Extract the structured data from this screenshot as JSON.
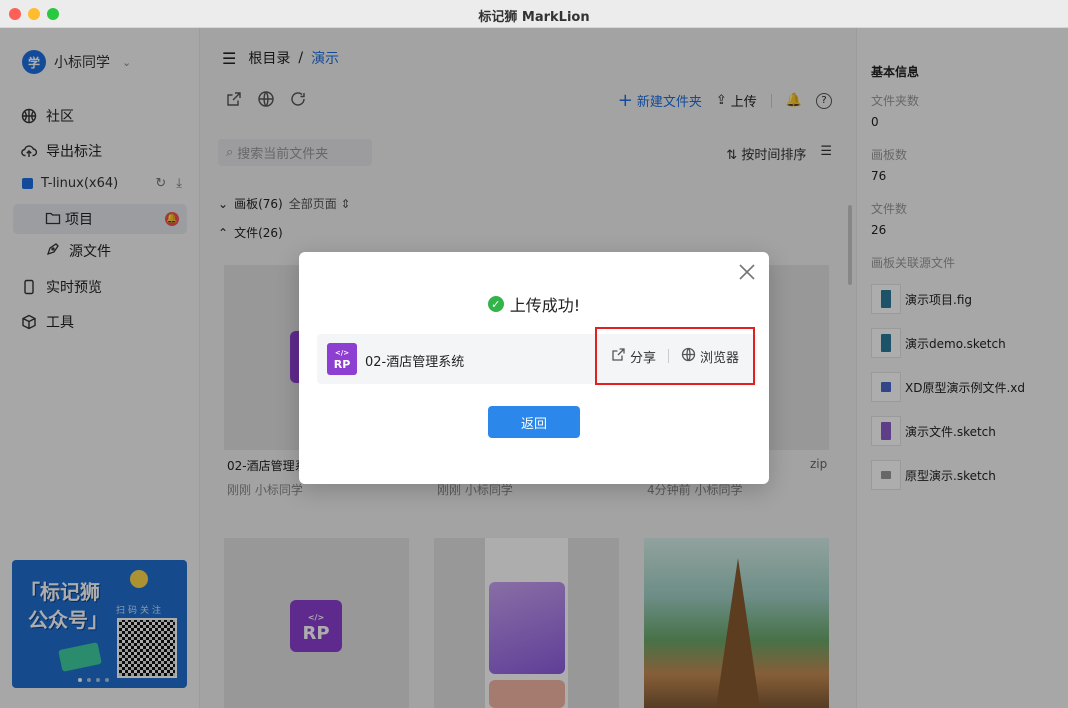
{
  "window": {
    "title": "标记狮 MarkLion"
  },
  "user": {
    "avatar_text": "学",
    "name": "小标同学"
  },
  "nav": {
    "community": "社区",
    "export": "导出标注",
    "workspace": "T-linux(x64)",
    "project": "项目",
    "source": "源文件",
    "preview": "实时预览",
    "tools": "工具"
  },
  "banner": {
    "title_line1": "「标记狮",
    "title_line2": "公众号」",
    "scan_text": "扫码关注"
  },
  "main": {
    "breadcrumb_root": "根目录",
    "breadcrumb_sep": "/",
    "breadcrumb_current": "演示",
    "new_folder": "新建文件夹",
    "upload": "上传",
    "search_placeholder": "搜索当前文件夹",
    "sort_label": "按时间排序",
    "boards_section": "画板(76)",
    "all_pages": "全部页面",
    "files_section": "文件(26)",
    "cards": [
      {
        "name": "02-酒店管理系",
        "meta": "刚刚 小标同学"
      },
      {
        "name": "",
        "meta": "刚刚 小标同学"
      },
      {
        "name": "zip",
        "meta": "4分钟前 小标同学"
      }
    ]
  },
  "panel": {
    "title": "基本信息",
    "folders_label": "文件夹数",
    "folders_value": "0",
    "boards_label": "画板数",
    "boards_value": "76",
    "files_label": "文件数",
    "files_value": "26",
    "linked_label": "画板关联源文件",
    "linked_files": [
      "演示项目.fig",
      "演示demo.sketch",
      "XD原型演示例文件.xd",
      "演示文件.sketch",
      "原型演示.sketch"
    ]
  },
  "modal": {
    "title": "上传成功!",
    "file_name": "02-酒店管理系统",
    "rp_label": "RP",
    "share": "分享",
    "browser": "浏览器",
    "back": "返回"
  },
  "colors": {
    "accent": "#1e6fe0",
    "success": "#34b34a",
    "highlight_border": "#e32020",
    "rp_purple": "#8c3fd1"
  }
}
